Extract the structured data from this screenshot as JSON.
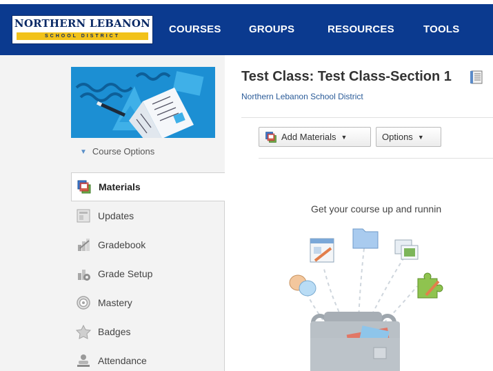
{
  "header": {
    "logo": {
      "name": "NORTHERN LEBANON",
      "sub": "SCHOOL DISTRICT"
    },
    "nav": [
      "COURSES",
      "GROUPS",
      "RESOURCES",
      "TOOLS"
    ],
    "colors": {
      "nav_bg": "#0b3a8f",
      "logo_gold": "#f2c21a",
      "card_blue": "#1c8fd3"
    }
  },
  "sidebar": {
    "course_options": "Course Options",
    "items": [
      {
        "label": "Materials",
        "icon": "materials-icon",
        "active": true
      },
      {
        "label": "Updates",
        "icon": "updates-icon"
      },
      {
        "label": "Gradebook",
        "icon": "gradebook-icon"
      },
      {
        "label": "Grade Setup",
        "icon": "grade-setup-icon"
      },
      {
        "label": "Mastery",
        "icon": "mastery-icon"
      },
      {
        "label": "Badges",
        "icon": "badges-icon"
      },
      {
        "label": "Attendance",
        "icon": "attendance-icon"
      }
    ]
  },
  "main": {
    "title": "Test Class: Test Class-Section 1",
    "district": "Northern Lebanon School District",
    "add_materials": "Add Materials",
    "options": "Options",
    "get_started": "Get your course up and runnin"
  }
}
